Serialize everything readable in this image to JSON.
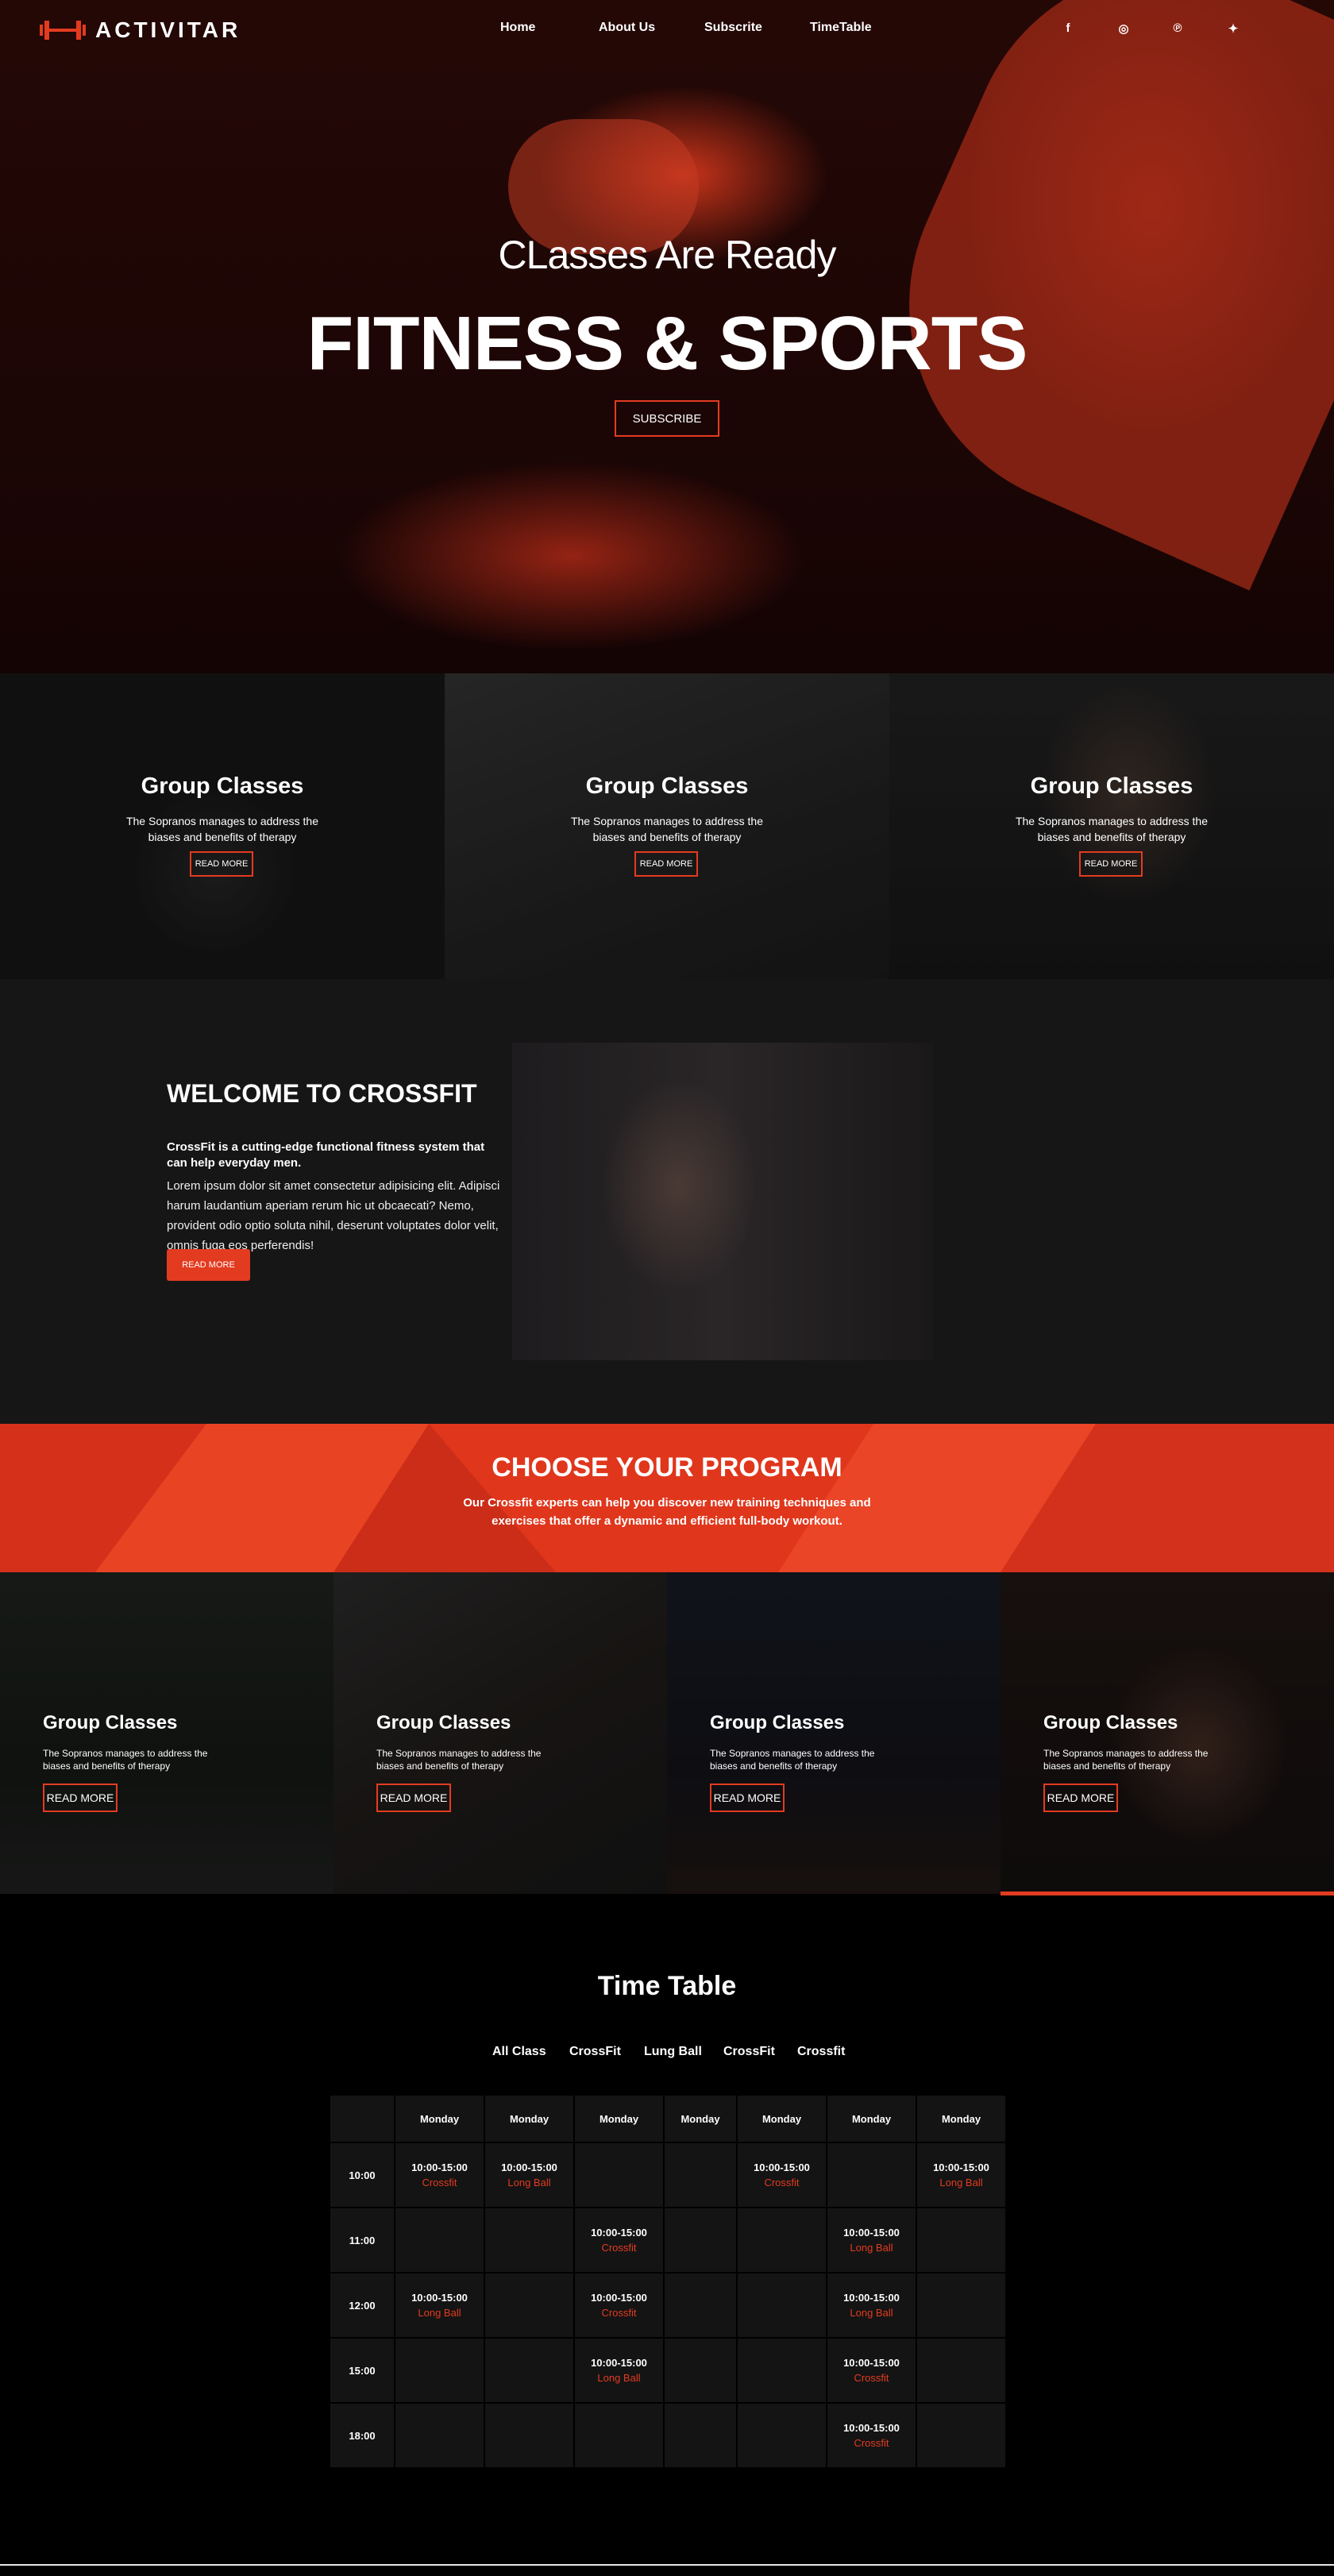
{
  "brand": {
    "name": "ACTIVITAR",
    "accent": "#e33b20"
  },
  "nav": [
    {
      "label": "Home"
    },
    {
      "label": "About Us"
    },
    {
      "label": "Subscrite"
    },
    {
      "label": "TimeTable"
    }
  ],
  "social": [
    {
      "icon": "facebook-icon",
      "glyph": "f"
    },
    {
      "icon": "instagram-icon",
      "glyph": "◎"
    },
    {
      "icon": "pinterest-icon",
      "glyph": "℗"
    },
    {
      "icon": "twitter-icon",
      "glyph": "✦"
    }
  ],
  "hero": {
    "subtitle": "CLasses Are Ready",
    "title": "FITNESS & SPORTS",
    "button": "SUBSCRIBE"
  },
  "group_cards": [
    {
      "title": "Group Classes",
      "desc": "The Sopranos manages to address the biases and benefits of therapy",
      "button": "READ MORE"
    },
    {
      "title": "Group Classes",
      "desc": "The Sopranos manages to address the biases and benefits of therapy",
      "button": "READ MORE"
    },
    {
      "title": "Group Classes",
      "desc": "The Sopranos manages to address the biases and benefits of therapy",
      "button": "READ MORE"
    }
  ],
  "welcome": {
    "title": "WELCOME TO CROSSFIT",
    "lead": "CrossFit is a cutting-edge functional fitness system that can help everyday men.",
    "body": "Lorem ipsum dolor sit amet consectetur adipisicing elit. Adipisci harum laudantium aperiam rerum hic ut obcaecati? Nemo, provident odio optio soluta nihil, deserunt voluptates dolor velit, omnis fuga eos perferendis!",
    "button": "READ MORE"
  },
  "program": {
    "title": "CHOOSE YOUR PROGRAM",
    "desc": "Our Crossfit experts can help you discover new training techniques and exercises that offer a dynamic and efficient full-body workout."
  },
  "program_cards": [
    {
      "title": "Group Classes",
      "desc": "The Sopranos manages to address the biases and benefits of therapy",
      "button": "READ MORE"
    },
    {
      "title": "Group Classes",
      "desc": "The Sopranos manages to address the biases and benefits of therapy",
      "button": "READ MORE"
    },
    {
      "title": "Group Classes",
      "desc": "The Sopranos manages to address the biases and benefits of therapy",
      "button": "READ MORE"
    },
    {
      "title": "Group Classes",
      "desc": "The Sopranos manages to address the biases and benefits of therapy",
      "button": "READ MORE"
    }
  ],
  "timetable": {
    "title": "Time Table",
    "filters": [
      "All Class",
      "CrossFit",
      "Lung Ball",
      "CrossFit",
      "Crossfit"
    ],
    "days": [
      "Monday",
      "Monday",
      "Monday",
      "Monday",
      "Monday",
      "Monday",
      "Monday"
    ],
    "rows": [
      {
        "hour": "10:00",
        "cells": [
          {
            "time": "10:00-15:00",
            "name": "Crossfit"
          },
          {
            "time": "10:00-15:00",
            "name": "Long Ball"
          },
          null,
          null,
          {
            "time": "10:00-15:00",
            "name": "Crossfit"
          },
          null,
          {
            "time": "10:00-15:00",
            "name": "Long Ball"
          }
        ]
      },
      {
        "hour": "11:00",
        "cells": [
          null,
          null,
          {
            "time": "10:00-15:00",
            "name": "Crossfit"
          },
          null,
          null,
          {
            "time": "10:00-15:00",
            "name": "Long Ball"
          },
          null
        ]
      },
      {
        "hour": "12:00",
        "cells": [
          {
            "time": "10:00-15:00",
            "name": "Long Ball"
          },
          null,
          {
            "time": "10:00-15:00",
            "name": "Crossfit"
          },
          null,
          null,
          {
            "time": "10:00-15:00",
            "name": "Long Ball"
          },
          null
        ]
      },
      {
        "hour": "15:00",
        "cells": [
          null,
          null,
          {
            "time": "10:00-15:00",
            "name": "Long Ball"
          },
          null,
          null,
          {
            "time": "10:00-15:00",
            "name": "Crossfit"
          },
          null
        ]
      },
      {
        "hour": "18:00",
        "cells": [
          null,
          null,
          null,
          null,
          null,
          {
            "time": "10:00-15:00",
            "name": "Crossfit"
          },
          null
        ]
      }
    ]
  }
}
